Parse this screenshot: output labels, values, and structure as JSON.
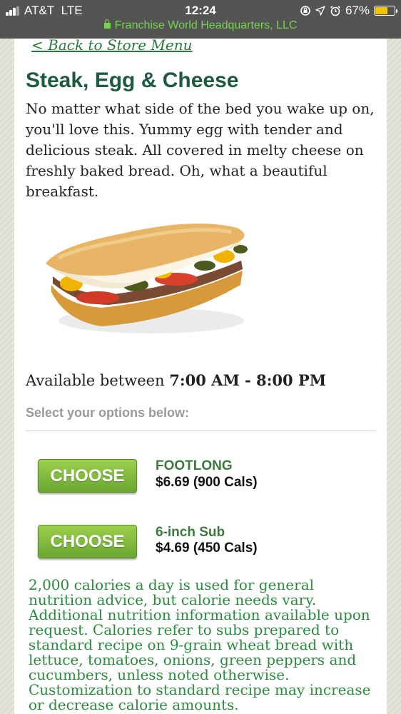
{
  "status_bar": {
    "carrier": "AT&T",
    "network": "LTE",
    "time": "12:24",
    "battery_percent": "67%",
    "battery_level": 0.67,
    "battery_color": "#f5c400",
    "icons": [
      "signal-icon",
      "screen-rotation-lock-icon",
      "location-arrow-icon",
      "alarm-icon",
      "battery-icon"
    ]
  },
  "browser": {
    "site_title": "Franchise World Headquarters, LLC",
    "secure": true,
    "url_color": "#74d44a"
  },
  "page": {
    "back_link": "< Back to Store Menu",
    "item_title": "Steak, Egg & Cheese",
    "description": "No matter what side of the bed you wake up on, you'll love this. Yummy egg with tender and delicious steak. All covered in melty cheese on freshly baked bread. Oh, what a beautiful breakfast.",
    "availability_prefix": "Available between ",
    "availability_hours": "7:00 AM - 8:00 PM",
    "options_label": "Select your options below:",
    "options": [
      {
        "button_label": "CHOOSE",
        "name": "FOOTLONG",
        "price": "$6.69 (900 Cals)"
      },
      {
        "button_label": "CHOOSE",
        "name": "6-inch Sub",
        "price": "$4.69 (450 Cals)"
      }
    ],
    "disclaimer": "2,000 calories a day is used for general nutrition advice, but calorie needs vary. Additional nutrition information available upon request. Calories refer to subs prepared to standard recipe on 9-grain wheat bread with lettuce, tomatoes, onions, green peppers and cucumbers, unless noted otherwise. Customization to standard recipe may increase or decrease calorie amounts."
  },
  "colors": {
    "title": "#1e5a40",
    "button": "#7bb83a",
    "option_name": "#3a7a3a",
    "disclaimer": "#2b8a3e"
  }
}
